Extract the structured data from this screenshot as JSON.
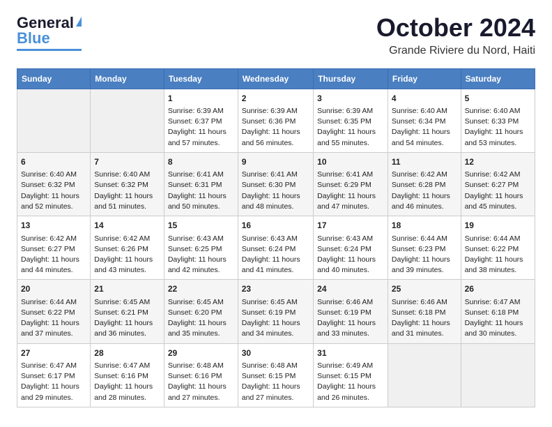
{
  "header": {
    "logo_line1": "General",
    "logo_line2": "Blue",
    "month": "October 2024",
    "location": "Grande Riviere du Nord, Haiti"
  },
  "days_of_week": [
    "Sunday",
    "Monday",
    "Tuesday",
    "Wednesday",
    "Thursday",
    "Friday",
    "Saturday"
  ],
  "weeks": [
    [
      {
        "day": "",
        "content": ""
      },
      {
        "day": "",
        "content": ""
      },
      {
        "day": "1",
        "content": "Sunrise: 6:39 AM\nSunset: 6:37 PM\nDaylight: 11 hours and 57 minutes."
      },
      {
        "day": "2",
        "content": "Sunrise: 6:39 AM\nSunset: 6:36 PM\nDaylight: 11 hours and 56 minutes."
      },
      {
        "day": "3",
        "content": "Sunrise: 6:39 AM\nSunset: 6:35 PM\nDaylight: 11 hours and 55 minutes."
      },
      {
        "day": "4",
        "content": "Sunrise: 6:40 AM\nSunset: 6:34 PM\nDaylight: 11 hours and 54 minutes."
      },
      {
        "day": "5",
        "content": "Sunrise: 6:40 AM\nSunset: 6:33 PM\nDaylight: 11 hours and 53 minutes."
      }
    ],
    [
      {
        "day": "6",
        "content": "Sunrise: 6:40 AM\nSunset: 6:32 PM\nDaylight: 11 hours and 52 minutes."
      },
      {
        "day": "7",
        "content": "Sunrise: 6:40 AM\nSunset: 6:32 PM\nDaylight: 11 hours and 51 minutes."
      },
      {
        "day": "8",
        "content": "Sunrise: 6:41 AM\nSunset: 6:31 PM\nDaylight: 11 hours and 50 minutes."
      },
      {
        "day": "9",
        "content": "Sunrise: 6:41 AM\nSunset: 6:30 PM\nDaylight: 11 hours and 48 minutes."
      },
      {
        "day": "10",
        "content": "Sunrise: 6:41 AM\nSunset: 6:29 PM\nDaylight: 11 hours and 47 minutes."
      },
      {
        "day": "11",
        "content": "Sunrise: 6:42 AM\nSunset: 6:28 PM\nDaylight: 11 hours and 46 minutes."
      },
      {
        "day": "12",
        "content": "Sunrise: 6:42 AM\nSunset: 6:27 PM\nDaylight: 11 hours and 45 minutes."
      }
    ],
    [
      {
        "day": "13",
        "content": "Sunrise: 6:42 AM\nSunset: 6:27 PM\nDaylight: 11 hours and 44 minutes."
      },
      {
        "day": "14",
        "content": "Sunrise: 6:42 AM\nSunset: 6:26 PM\nDaylight: 11 hours and 43 minutes."
      },
      {
        "day": "15",
        "content": "Sunrise: 6:43 AM\nSunset: 6:25 PM\nDaylight: 11 hours and 42 minutes."
      },
      {
        "day": "16",
        "content": "Sunrise: 6:43 AM\nSunset: 6:24 PM\nDaylight: 11 hours and 41 minutes."
      },
      {
        "day": "17",
        "content": "Sunrise: 6:43 AM\nSunset: 6:24 PM\nDaylight: 11 hours and 40 minutes."
      },
      {
        "day": "18",
        "content": "Sunrise: 6:44 AM\nSunset: 6:23 PM\nDaylight: 11 hours and 39 minutes."
      },
      {
        "day": "19",
        "content": "Sunrise: 6:44 AM\nSunset: 6:22 PM\nDaylight: 11 hours and 38 minutes."
      }
    ],
    [
      {
        "day": "20",
        "content": "Sunrise: 6:44 AM\nSunset: 6:22 PM\nDaylight: 11 hours and 37 minutes."
      },
      {
        "day": "21",
        "content": "Sunrise: 6:45 AM\nSunset: 6:21 PM\nDaylight: 11 hours and 36 minutes."
      },
      {
        "day": "22",
        "content": "Sunrise: 6:45 AM\nSunset: 6:20 PM\nDaylight: 11 hours and 35 minutes."
      },
      {
        "day": "23",
        "content": "Sunrise: 6:45 AM\nSunset: 6:19 PM\nDaylight: 11 hours and 34 minutes."
      },
      {
        "day": "24",
        "content": "Sunrise: 6:46 AM\nSunset: 6:19 PM\nDaylight: 11 hours and 33 minutes."
      },
      {
        "day": "25",
        "content": "Sunrise: 6:46 AM\nSunset: 6:18 PM\nDaylight: 11 hours and 31 minutes."
      },
      {
        "day": "26",
        "content": "Sunrise: 6:47 AM\nSunset: 6:18 PM\nDaylight: 11 hours and 30 minutes."
      }
    ],
    [
      {
        "day": "27",
        "content": "Sunrise: 6:47 AM\nSunset: 6:17 PM\nDaylight: 11 hours and 29 minutes."
      },
      {
        "day": "28",
        "content": "Sunrise: 6:47 AM\nSunset: 6:16 PM\nDaylight: 11 hours and 28 minutes."
      },
      {
        "day": "29",
        "content": "Sunrise: 6:48 AM\nSunset: 6:16 PM\nDaylight: 11 hours and 27 minutes."
      },
      {
        "day": "30",
        "content": "Sunrise: 6:48 AM\nSunset: 6:15 PM\nDaylight: 11 hours and 27 minutes."
      },
      {
        "day": "31",
        "content": "Sunrise: 6:49 AM\nSunset: 6:15 PM\nDaylight: 11 hours and 26 minutes."
      },
      {
        "day": "",
        "content": ""
      },
      {
        "day": "",
        "content": ""
      }
    ]
  ]
}
